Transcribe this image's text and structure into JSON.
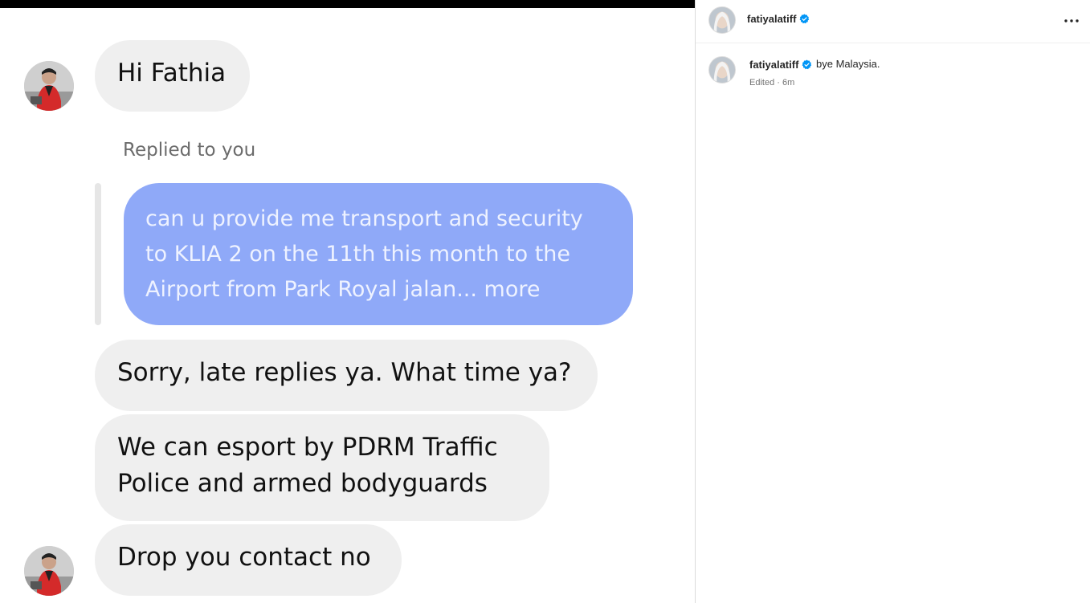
{
  "chat": {
    "messages": {
      "greeting": "Hi Fathia",
      "replied_label": "Replied to you",
      "quoted_line1": "can u provide me transport and security",
      "quoted_line2": "to KLIA 2 on the 11th this month to the",
      "quoted_line3": "Airport from Park Royal jalan... more",
      "sorry": "Sorry, late replies ya. What time ya?",
      "escort_line1": "We can esport by PDRM Traffic",
      "escort_line2": "Police and armed bodyguards",
      "contact": "Drop you contact no"
    }
  },
  "post": {
    "header_username": "fatiyalatiff",
    "caption_username": "fatiyalatiff",
    "caption_text": "bye Malaysia.",
    "meta": "Edited · 6m",
    "more_icon": "more-horizontal-icon",
    "verified_color": "#0095f6"
  }
}
